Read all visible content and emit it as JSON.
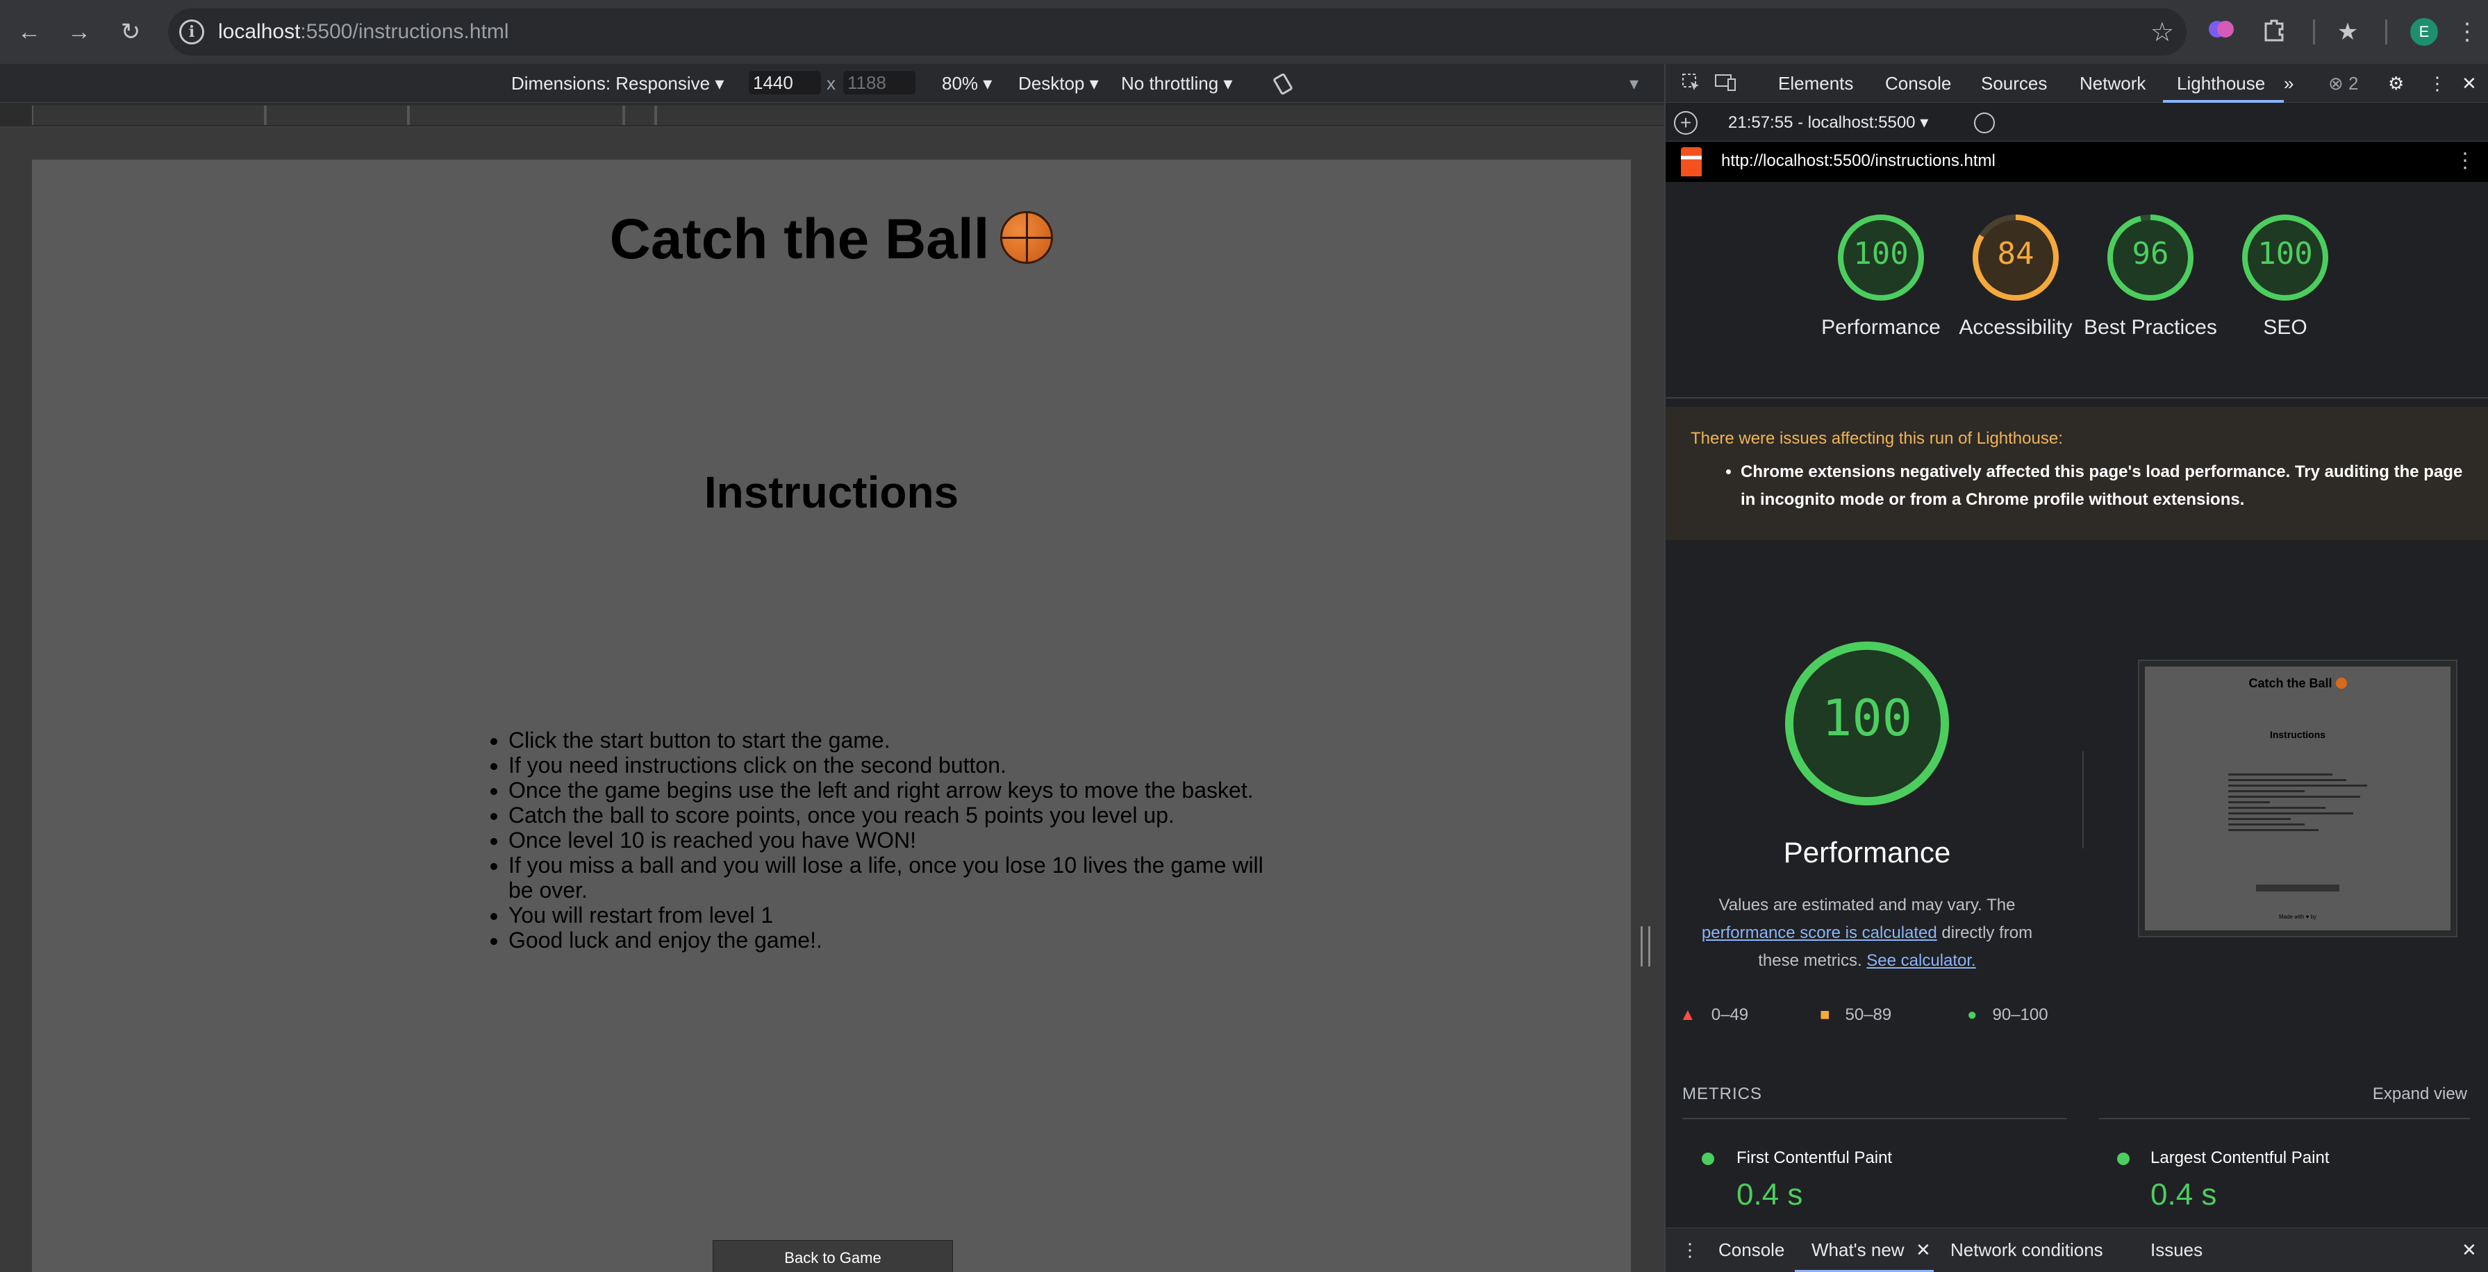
{
  "browser": {
    "url_host": "localhost",
    "url_rest": ":5500/instructions.html",
    "back_icon": "←",
    "forward_icon": "→",
    "reload_icon": "↻",
    "info_icon": "i",
    "bookmark_icon": "☆",
    "profile_initial": "E"
  },
  "device_toolbar": {
    "dimensions_label": "Dimensions: Responsive ▾",
    "width": "1440",
    "times": "x",
    "height_placeholder": "1188",
    "zoom": "80% ▾",
    "device_type": "Desktop ▾",
    "throttling": "No throttling ▾",
    "more_icon": "▾"
  },
  "page": {
    "title": "Catch the Ball",
    "heading": "Instructions",
    "instructions": [
      "Click the start button to start the game.",
      "If you need instructions click on the second button.",
      "Once the game begins use the left and right arrow keys to move the basket.",
      "Catch the ball to score points, once you reach 5 points you level up.",
      "Once level 10 is reached you have WON!",
      "If you miss a ball and you will lose a life, once you lose 10 lives the game will be over.",
      "You will restart from level 1",
      "Good luck and enjoy the game!."
    ],
    "back_button": "Back to Game"
  },
  "devtools": {
    "tabs": [
      "Elements",
      "Console",
      "Sources",
      "Network",
      "Lighthouse"
    ],
    "more_tabs": "»",
    "issues_count": "2",
    "run_label": "21:57:55 - localhost:5500 ▾",
    "report_url": "http://localhost:5500/instructions.html",
    "scores": [
      {
        "label": "Performance",
        "score": 100,
        "color": "#4cce5e"
      },
      {
        "label": "Accessibility",
        "score": 84,
        "color": "#f4a93a"
      },
      {
        "label": "Best Practices",
        "score": 96,
        "color": "#4cce5e"
      },
      {
        "label": "SEO",
        "score": 100,
        "color": "#4cce5e"
      }
    ],
    "warning_title": "There were issues affecting this run of Lighthouse:",
    "warning_item": "Chrome extensions negatively affected this page's load performance. Try auditing the page in incognito mode or from a Chrome profile without extensions.",
    "big_score": "100",
    "big_label": "Performance",
    "desc_pre": "Values are estimated and may vary. The ",
    "desc_link1": "performance score is calculated",
    "desc_mid": " directly from these metrics. ",
    "desc_link2": "See calculator.",
    "thumb_title": "Catch the Ball",
    "thumb_heading": "Instructions",
    "thumb_footer": "Made with ♥ by",
    "legend": [
      "0–49",
      "50–89",
      "90–100"
    ],
    "metrics_head": "METRICS",
    "expand_view": "Expand view",
    "metrics": [
      {
        "name": "First Contentful Paint",
        "value": "0.4 s"
      },
      {
        "name": "Largest Contentful Paint",
        "value": "0.4 s"
      }
    ],
    "drawer_tabs": [
      "Console",
      "What's new",
      "Network conditions",
      "Issues"
    ]
  }
}
